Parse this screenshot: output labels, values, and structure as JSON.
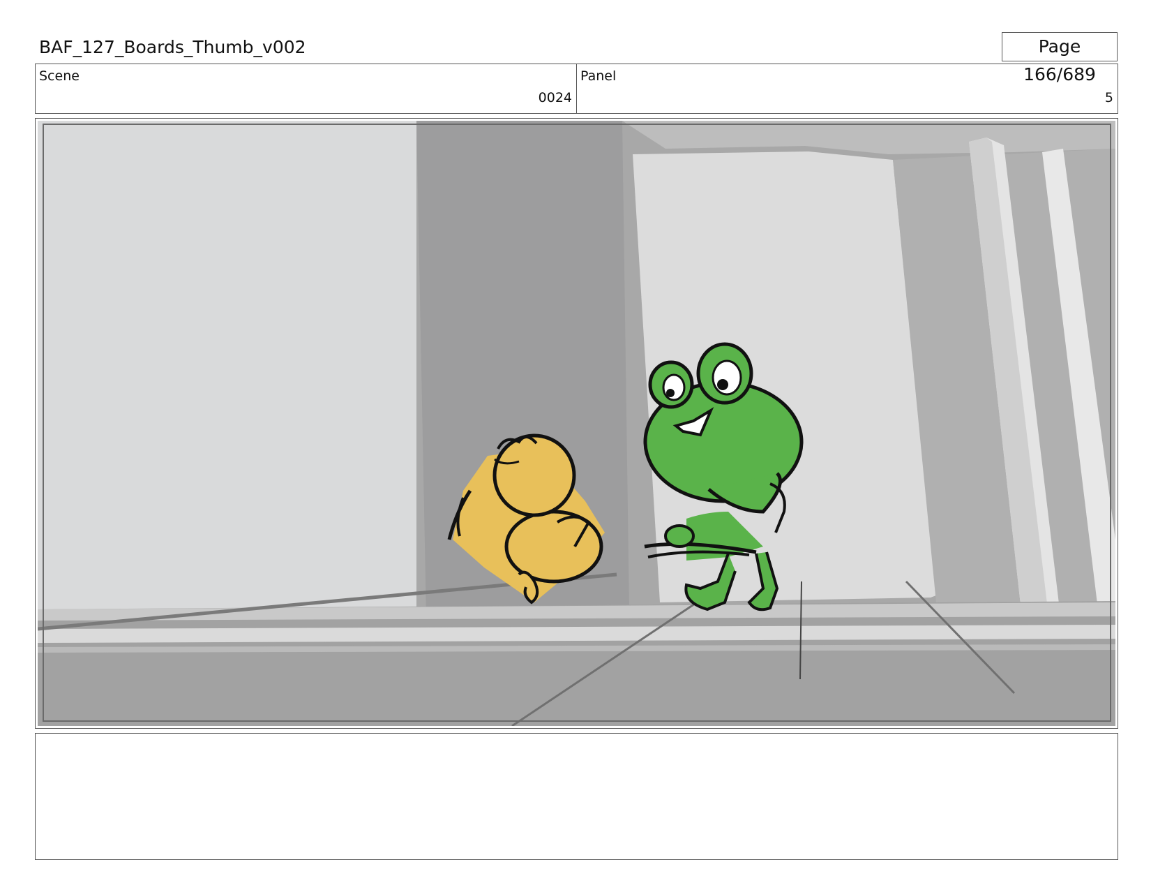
{
  "header": {
    "title": "BAF_127_Boards_Thumb_v002",
    "page": "Page 166/689"
  },
  "info": {
    "scene_label": "Scene",
    "scene_value": "0024",
    "panel_label": "Panel",
    "panel_value": "5"
  },
  "frame": {
    "description_icon": "storyboard-frame-image"
  },
  "notes": {
    "text": ""
  },
  "colors": {
    "frog_green": "#5ab34a",
    "chick_yellow": "#e8c05a",
    "outline": "#111111"
  }
}
